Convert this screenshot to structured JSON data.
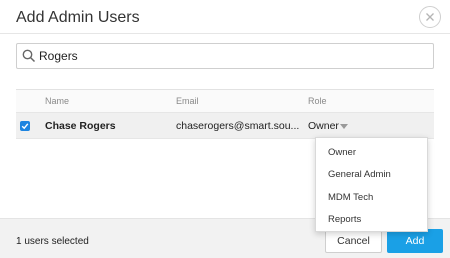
{
  "modal": {
    "title": "Add Admin Users"
  },
  "search": {
    "value": "Rogers"
  },
  "table": {
    "headers": [
      "Name",
      "Email",
      "Role"
    ],
    "rows": [
      {
        "selected": true,
        "name": "Chase Rogers",
        "email": "chaserogers@smart.sou...",
        "role": "Owner"
      }
    ]
  },
  "role_dropdown": {
    "options": [
      "Owner",
      "General Admin",
      "MDM Tech",
      "Reports"
    ]
  },
  "footer": {
    "selected_text": "1 users selected",
    "cancel_label": "Cancel",
    "add_label": "Add"
  },
  "colors": {
    "accent": "#1aa0e6",
    "checkbox": "#1d84e0",
    "row_highlight": "#f0f0f0",
    "footer_bg": "#f2f2f2"
  },
  "icons": {
    "close": "close-icon",
    "search": "search-icon",
    "checkbox": "check-icon",
    "caret": "caret-down-icon"
  }
}
